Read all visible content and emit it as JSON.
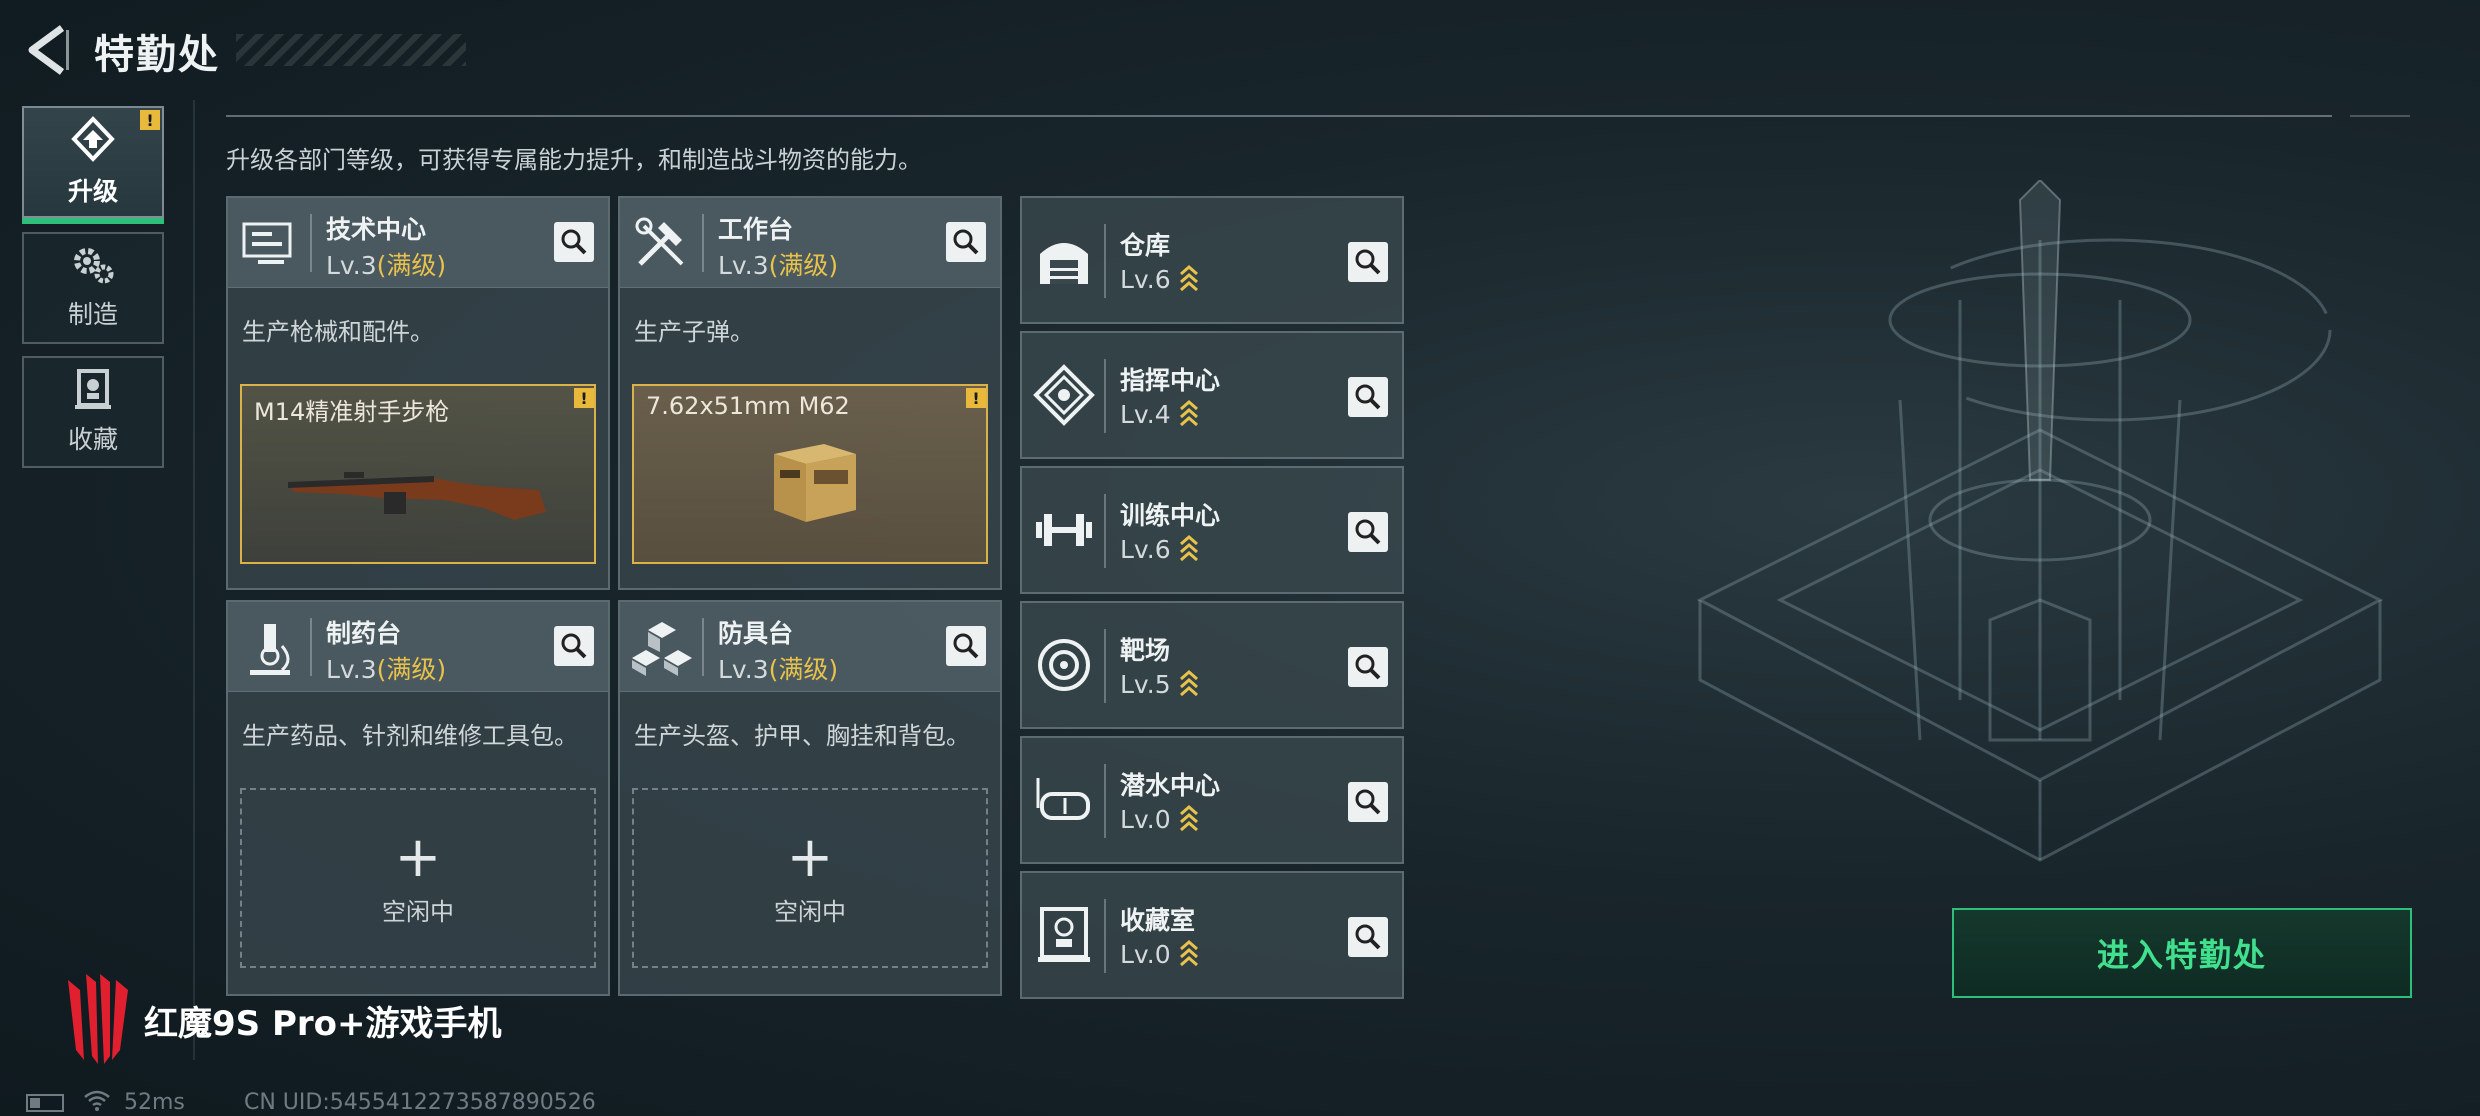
{
  "header": {
    "title": "特勤处"
  },
  "sidebar": {
    "tabs": [
      {
        "label": "升级",
        "icon": "upgrade-icon",
        "active": true,
        "badge": "!"
      },
      {
        "label": "制造",
        "icon": "gear-icon",
        "active": false
      },
      {
        "label": "收藏",
        "icon": "collection-icon",
        "active": false
      }
    ]
  },
  "intro": "升级各部门等级，可获得专属能力提升，和制造战斗物资的能力。",
  "production_departments": [
    {
      "name": "技术中心",
      "level": "Lv.3",
      "level_tag": "(满级)",
      "icon": "computer-icon",
      "description": "生产枪械和配件。",
      "status": "producing",
      "item": "M14精准射手步枪",
      "badge": "!"
    },
    {
      "name": "工作台",
      "level": "Lv.3",
      "level_tag": "(满级)",
      "icon": "tools-icon",
      "description": "生产子弹。",
      "status": "producing",
      "item": "7.62x51mm M62",
      "badge": "!"
    },
    {
      "name": "制药台",
      "level": "Lv.3",
      "level_tag": "(满级)",
      "icon": "microscope-icon",
      "description": "生产药品、针剂和维修工具包。",
      "status": "idle",
      "idle_label": "空闲中"
    },
    {
      "name": "防具台",
      "level": "Lv.3",
      "level_tag": "(满级)",
      "icon": "armor-blocks-icon",
      "description": "生产头盔、护甲、胸挂和背包。",
      "status": "idle",
      "idle_label": "空闲中"
    }
  ],
  "other_departments": [
    {
      "name": "仓库",
      "level": "Lv.6",
      "icon": "warehouse-icon"
    },
    {
      "name": "指挥中心",
      "level": "Lv.4",
      "icon": "command-icon"
    },
    {
      "name": "训练中心",
      "level": "Lv.6",
      "icon": "dumbbell-icon"
    },
    {
      "name": "靶场",
      "level": "Lv.5",
      "icon": "target-icon"
    },
    {
      "name": "潜水中心",
      "level": "Lv.0",
      "icon": "diving-mask-icon"
    },
    {
      "name": "收藏室",
      "level": "Lv.0",
      "icon": "trophy-case-icon"
    }
  ],
  "enter_button": "进入特勤处",
  "watermark": "红魔9S Pro+游戏手机",
  "status_bar": {
    "ping": "52ms",
    "uid": "CN UID:5455412273587890526"
  },
  "colors": {
    "accent_green": "#2ec07a",
    "gold": "#e8c24a",
    "warning": "#e8b93a"
  }
}
